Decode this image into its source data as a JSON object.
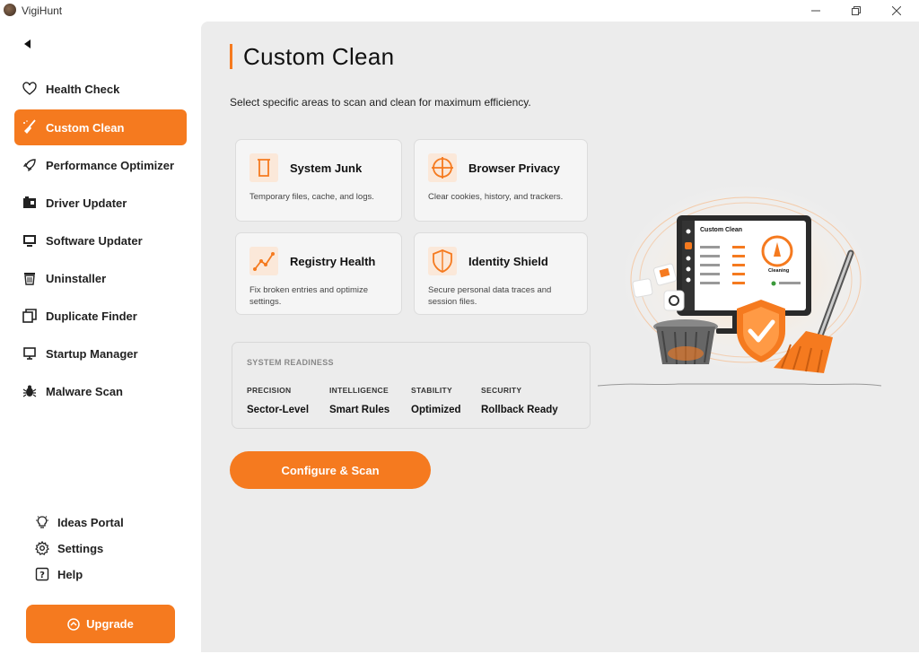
{
  "window": {
    "title": "VigiHunt"
  },
  "sidebar": {
    "items": [
      {
        "label": "Health Check",
        "icon": "heart-icon"
      },
      {
        "label": "Custom Clean",
        "icon": "broom-icon",
        "active": true
      },
      {
        "label": "Performance Optimizer",
        "icon": "rocket-icon"
      },
      {
        "label": "Driver Updater",
        "icon": "driver-icon"
      },
      {
        "label": "Software Updater",
        "icon": "monitor-icon"
      },
      {
        "label": "Uninstaller",
        "icon": "trash-icon"
      },
      {
        "label": "Duplicate Finder",
        "icon": "copy-icon"
      },
      {
        "label": "Startup Manager",
        "icon": "desktop-icon"
      },
      {
        "label": "Malware Scan",
        "icon": "bug-icon"
      }
    ],
    "bottom": [
      {
        "label": "Ideas Portal",
        "icon": "lightbulb-icon"
      },
      {
        "label": "Settings",
        "icon": "gear-icon"
      },
      {
        "label": "Help",
        "icon": "help-icon"
      }
    ],
    "upgrade_label": "Upgrade"
  },
  "main": {
    "title": "Custom Clean",
    "subtitle": "Select specific areas to scan and clean for maximum efficiency.",
    "cards": [
      {
        "title": "System Junk",
        "desc": "Temporary files, cache, and logs.",
        "icon": "junk-icon"
      },
      {
        "title": "Browser Privacy",
        "desc": "Clear cookies, history, and trackers.",
        "icon": "crosshair-icon"
      },
      {
        "title": "Registry Health",
        "desc": "Fix broken entries and optimize settings.",
        "icon": "chart-line-icon"
      },
      {
        "title": "Identity Shield",
        "desc": "Secure personal data traces and session files.",
        "icon": "shield-icon"
      }
    ],
    "readiness": {
      "title": "SYSTEM READINESS",
      "columns": [
        {
          "label": "PRECISION",
          "value": "Sector-Level"
        },
        {
          "label": "INTELLIGENCE",
          "value": "Smart Rules"
        },
        {
          "label": "STABILITY",
          "value": "Optimized"
        },
        {
          "label": "SECURITY",
          "value": "Rollback Ready"
        }
      ]
    },
    "scan_button_label": "Configure & Scan"
  },
  "illustration": {
    "screen_title": "Custom Clean",
    "status": "Cleaning"
  },
  "colors": {
    "accent": "#f57a1f",
    "panel_bg": "#ececec"
  }
}
